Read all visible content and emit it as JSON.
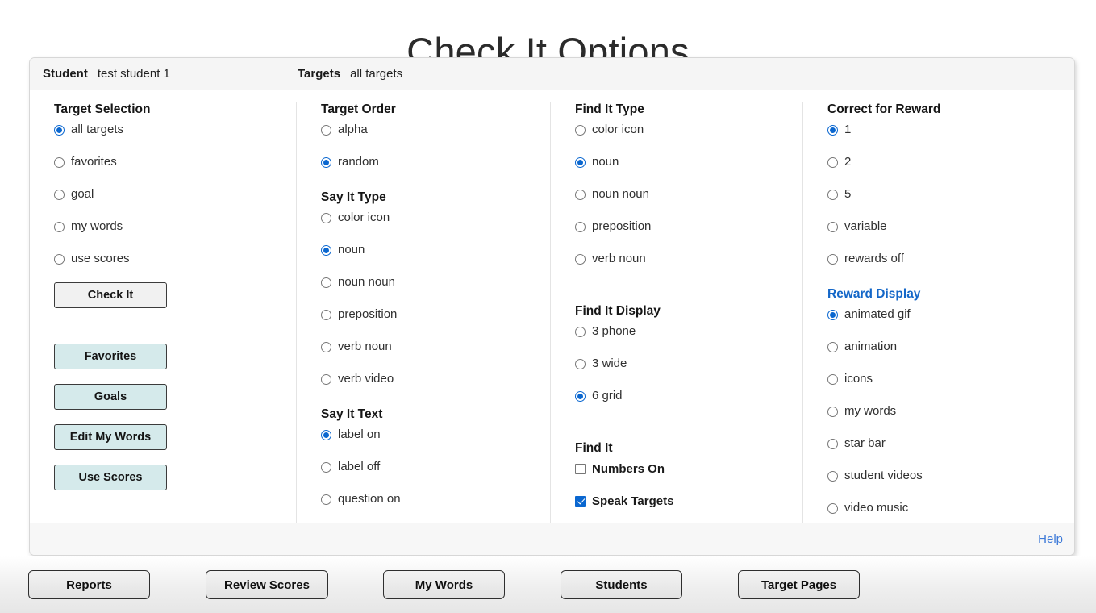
{
  "page": {
    "title": "Check It Options"
  },
  "header": {
    "student_label": "Student",
    "student_value": "test student 1",
    "targets_label": "Targets",
    "targets_value": "all targets"
  },
  "columns": {
    "target_selection": {
      "title": "Target Selection",
      "options": [
        {
          "label": "all targets",
          "selected": true
        },
        {
          "label": "favorites",
          "selected": false
        },
        {
          "label": "goal",
          "selected": false
        },
        {
          "label": "my words",
          "selected": false
        },
        {
          "label": "use scores",
          "selected": false
        }
      ],
      "buttons": [
        {
          "label": "Check It",
          "style": "gray"
        },
        {
          "label": "Favorites",
          "style": "teal"
        },
        {
          "label": "Goals",
          "style": "teal"
        },
        {
          "label": "Edit My Words",
          "style": "teal"
        },
        {
          "label": "Use Scores",
          "style": "teal"
        }
      ]
    },
    "target_order": {
      "title": "Target Order",
      "options": [
        {
          "label": "alpha",
          "selected": false
        },
        {
          "label": "random",
          "selected": true
        }
      ]
    },
    "say_it_type": {
      "title": "Say It Type",
      "options": [
        {
          "label": "color icon",
          "selected": false
        },
        {
          "label": "noun",
          "selected": true
        },
        {
          "label": "noun noun",
          "selected": false
        },
        {
          "label": "preposition",
          "selected": false
        },
        {
          "label": "verb noun",
          "selected": false
        },
        {
          "label": "verb video",
          "selected": false
        }
      ]
    },
    "say_it_text": {
      "title": "Say It Text",
      "options": [
        {
          "label": "label on",
          "selected": true
        },
        {
          "label": "label off",
          "selected": false
        },
        {
          "label": "question on",
          "selected": false
        }
      ]
    },
    "find_it_type": {
      "title": "Find It Type",
      "options": [
        {
          "label": "color icon",
          "selected": false
        },
        {
          "label": "noun",
          "selected": true
        },
        {
          "label": "noun noun",
          "selected": false
        },
        {
          "label": "preposition",
          "selected": false
        },
        {
          "label": "verb noun",
          "selected": false
        }
      ]
    },
    "find_it_display": {
      "title": "Find It Display",
      "options": [
        {
          "label": "3 phone",
          "selected": false
        },
        {
          "label": "3 wide",
          "selected": false
        },
        {
          "label": "6 grid",
          "selected": true
        }
      ]
    },
    "find_it": {
      "title": "Find It",
      "checkboxes": [
        {
          "label": "Numbers On",
          "checked": false
        },
        {
          "label": "Speak Targets",
          "checked": true
        }
      ]
    },
    "correct_for_reward": {
      "title": "Correct for Reward",
      "options": [
        {
          "label": "1",
          "selected": true
        },
        {
          "label": "2",
          "selected": false
        },
        {
          "label": "5",
          "selected": false
        },
        {
          "label": "variable",
          "selected": false
        },
        {
          "label": "rewards off",
          "selected": false
        }
      ]
    },
    "reward_display": {
      "title": "Reward Display",
      "title_color": "#1467c8",
      "options": [
        {
          "label": "animated gif",
          "selected": true
        },
        {
          "label": "animation",
          "selected": false
        },
        {
          "label": "icons",
          "selected": false
        },
        {
          "label": "my words",
          "selected": false
        },
        {
          "label": "star bar",
          "selected": false
        },
        {
          "label": "student videos",
          "selected": false
        },
        {
          "label": "video music",
          "selected": false
        }
      ]
    }
  },
  "footer": {
    "help_label": "Help"
  },
  "bottom_bar": {
    "buttons": [
      {
        "label": "Reports"
      },
      {
        "label": "Review Scores"
      },
      {
        "label": "My Words"
      },
      {
        "label": "Students"
      },
      {
        "label": "Target Pages"
      }
    ]
  }
}
